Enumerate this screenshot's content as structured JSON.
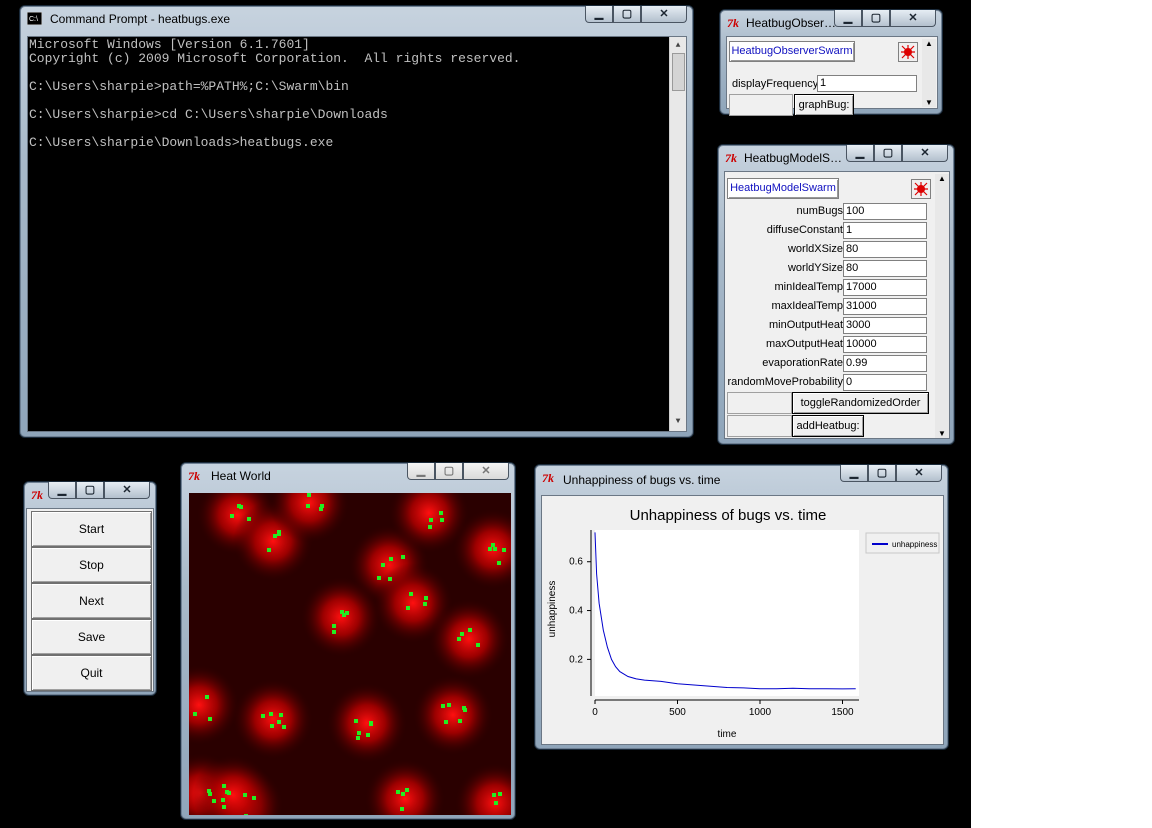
{
  "cmd_window": {
    "title": "Command Prompt - heatbugs.exe",
    "lines": [
      "Microsoft Windows [Version 6.1.7601]",
      "Copyright (c) 2009 Microsoft Corporation.  All rights reserved.",
      "",
      "C:\\Users\\sharpie>path=%PATH%;C:\\Swarm\\bin",
      "",
      "C:\\Users\\sharpie>cd C:\\Users\\sharpie\\Downloads",
      "",
      "C:\\Users\\sharpie\\Downloads>heatbugs.exe"
    ]
  },
  "observer_window": {
    "title": "HeatbugObser…",
    "swarm_button": "HeatbugObserverSwarm",
    "field_label": "displayFrequency",
    "field_value": "1",
    "action_button": "graphBug:"
  },
  "model_window": {
    "title": "HeatbugModelS…",
    "swarm_button": "HeatbugModelSwarm",
    "params": [
      {
        "label": "numBugs",
        "value": "100"
      },
      {
        "label": "diffuseConstant",
        "value": "1"
      },
      {
        "label": "worldXSize",
        "value": "80"
      },
      {
        "label": "worldYSize",
        "value": "80"
      },
      {
        "label": "minIdealTemp",
        "value": "17000"
      },
      {
        "label": "maxIdealTemp",
        "value": "31000"
      },
      {
        "label": "minOutputHeat",
        "value": "3000"
      },
      {
        "label": "maxOutputHeat",
        "value": "10000"
      },
      {
        "label": "evaporationRate",
        "value": "0.99"
      },
      {
        "label": "randomMoveProbability",
        "value": "0"
      }
    ],
    "button1": "toggleRandomizedOrder",
    "button2": "addHeatbug:"
  },
  "control_window": {
    "buttons": [
      "Start",
      "Stop",
      "Next",
      "Save",
      "Quit"
    ]
  },
  "heat_window": {
    "title": "Heat World"
  },
  "graph_window": {
    "title": "Unhappiness of bugs vs. time"
  },
  "chart_data": {
    "type": "line",
    "title": "Unhappiness of bugs vs. time",
    "xlabel": "time",
    "ylabel": "unhappiness",
    "xlim": [
      0,
      1600
    ],
    "ylim": [
      0.05,
      0.73
    ],
    "x_ticks": [
      0,
      500,
      1000,
      1500
    ],
    "y_ticks": [
      0.2,
      0.4,
      0.6
    ],
    "x_tick_labels": [
      "0",
      "500",
      "1000",
      "1500"
    ],
    "y_tick_labels": [
      "0.2",
      "0.4",
      "0.6"
    ],
    "legend": "top-right",
    "series": [
      {
        "name": "unhappiness",
        "color": "#0000cc",
        "x": [
          0,
          10,
          25,
          50,
          75,
          100,
          125,
          150,
          200,
          250,
          300,
          400,
          500,
          600,
          700,
          800,
          900,
          1000,
          1100,
          1200,
          1300,
          1400,
          1500,
          1580
        ],
        "y": [
          0.72,
          0.55,
          0.43,
          0.32,
          0.25,
          0.2,
          0.17,
          0.15,
          0.13,
          0.12,
          0.115,
          0.11,
          0.1,
          0.095,
          0.09,
          0.085,
          0.083,
          0.08,
          0.08,
          0.082,
          0.08,
          0.08,
          0.079,
          0.08
        ]
      }
    ]
  }
}
